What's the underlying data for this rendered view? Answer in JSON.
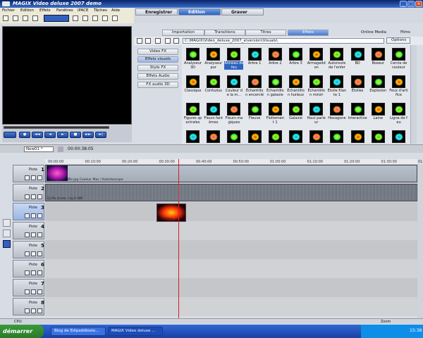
{
  "window": {
    "title": "MAGIX  Video deluxe 2007 demo",
    "logo_text": "MAGIX"
  },
  "menu": [
    "Fichier",
    "Edition",
    "Effets",
    "Fenêtres",
    "iPACE",
    "Tâches",
    "Aide"
  ],
  "mode_tabs": [
    "Enregistrer",
    "Edition",
    "Graver"
  ],
  "fx_tabs": [
    "Importation",
    "Transitions",
    "Titres",
    "Effets"
  ],
  "fx_tabs_extra": [
    "Online Media",
    "Films"
  ],
  "path": "C:\\MAGIX\\Video_deluxe_2007_e\\version\\Visuals\\",
  "options_label": "Options",
  "categories": [
    "Video FX",
    "Effets visuels",
    "Style FX",
    "Effets Audio",
    "FX audio 3D"
  ],
  "effects": [
    "Analyseur 3D",
    "Analyseur pur",
    "Anneau de feu",
    "Arbre 1",
    "Arbre 2",
    "Arbre 3",
    "Armageddon",
    "Autoroute de l'enfer",
    "BD",
    "Boxeur",
    "Cercle de couleur",
    "Classique",
    "Confuzius",
    "Couleur de la m...",
    "Échantillon encerclé",
    "Échantillon galaxie",
    "Échantillon huileux",
    "Échantillon miroir",
    "Étoile filante 1",
    "Étoiles",
    "Explosion",
    "Feux d'artifice",
    "Figures spectrales",
    "Fleurs fantômes",
    "Fleurs magiques",
    "Fleuve",
    "Flottement 1",
    "Galaxie",
    "Haut parleur",
    "Hexagone",
    "Interactive",
    "Laine",
    "Ligne de feu",
    "",
    "",
    "",
    "",
    "",
    "",
    "",
    "",
    "",
    "",
    ""
  ],
  "selected_effect_index": 2,
  "project": {
    "name": "New01 *",
    "timecode": "00:00:38:05"
  },
  "ruler": [
    "00:00:00",
    "00:10:00",
    "00:20:00",
    "00:30:00",
    "00:40:00",
    "00:50:00",
    "01:00:00",
    "01:10:00",
    "01:20:00",
    "01:30:00",
    "01:40:00"
  ],
  "tracks": [
    {
      "num": "1",
      "label": "Piste",
      "clip": "EdipaddlelastBz.jpg   Couleur Mac / Kaleidoscope"
    },
    {
      "num": "2",
      "label": "Piste",
      "clip": "DJ No stress .mp3 HDF"
    },
    {
      "num": "3",
      "label": "Piste",
      "clip": "Fire Ring"
    },
    {
      "num": "4",
      "label": "Piste",
      "clip": ""
    },
    {
      "num": "5",
      "label": "Piste",
      "clip": ""
    },
    {
      "num": "6",
      "label": "Piste",
      "clip": ""
    },
    {
      "num": "7",
      "label": "Piste",
      "clip": ""
    },
    {
      "num": "8",
      "label": "Piste",
      "clip": ""
    }
  ],
  "status": {
    "cpu": "CPU:",
    "zoom": "Zoom"
  },
  "taskbar": {
    "start": "démarrer",
    "tasks": [
      "Blog de Edipaddlesto...",
      "MAGIX Video deluxe ..."
    ],
    "clock": "15:38"
  },
  "colors": {
    "accent": "#2f62c0",
    "playhead": "#d42020",
    "desktop": "#1941a5"
  }
}
